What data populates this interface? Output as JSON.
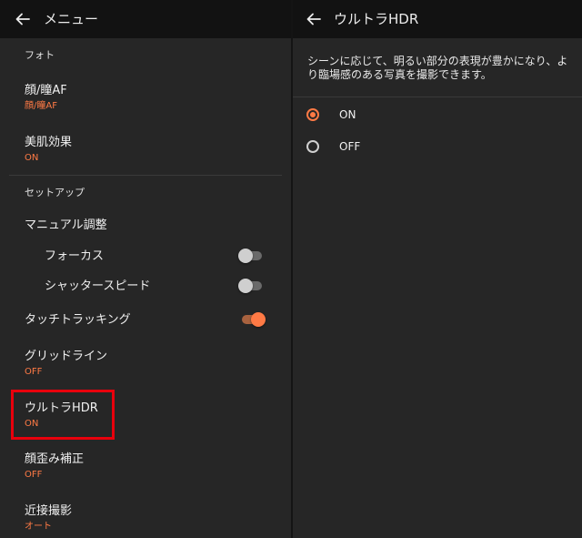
{
  "left": {
    "title": "メニュー",
    "back_icon": "back-arrow-icon",
    "items": {
      "photo_section": "フォト",
      "face_eye_af": {
        "title": "顔/瞳AF",
        "value": "顔/瞳AF"
      },
      "beauty": {
        "title": "美肌効果",
        "value": "ON"
      },
      "setup_section": "セットアップ",
      "manual_adjust": "マニュアル調整",
      "focus": {
        "title": "フォーカス",
        "toggle_on": false
      },
      "shutter_speed": {
        "title": "シャッタースピード",
        "toggle_on": false
      },
      "touch_tracking": {
        "title": "タッチトラッキング",
        "toggle_on": true
      },
      "gridline": {
        "title": "グリッドライン",
        "value": "OFF"
      },
      "ultra_hdr": {
        "title": "ウルトラHDR",
        "value": "ON"
      },
      "distortion": {
        "title": "顔歪み補正",
        "value": "OFF"
      },
      "macro": {
        "title": "近接撮影",
        "value": "オート"
      }
    }
  },
  "right": {
    "title": "ウルトラHDR",
    "back_icon": "back-arrow-icon",
    "description": "シーンに応じて、明るい部分の表現が豊かになり、より臨場感のある写真を撮影できます。",
    "options": [
      {
        "label": "ON",
        "selected": true
      },
      {
        "label": "OFF",
        "selected": false
      }
    ]
  },
  "colors": {
    "accent": "#ff7a45",
    "highlight": "#e8000c",
    "background": "#262626",
    "appbar": "#121212"
  }
}
